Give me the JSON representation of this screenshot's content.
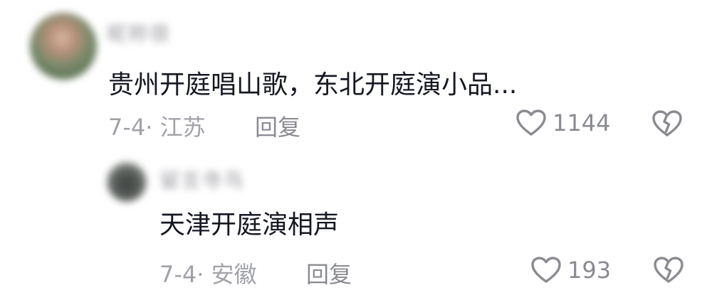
{
  "comments": [
    {
      "username": "昵称很",
      "text": "贵州开庭唱山歌，东北开庭演小品...",
      "meta": "7-4· 江苏",
      "reply_label": "回复",
      "likes": "1144"
    }
  ],
  "replies": [
    {
      "username": "留言寺鸟",
      "text": "天津开庭演相声",
      "meta": "7-4· 安徽",
      "reply_label": "回复",
      "likes": "193"
    }
  ],
  "icons": {
    "like": "heart-icon",
    "dislike": "broken-heart-icon"
  },
  "colors": {
    "text": "#161823",
    "secondary": "#a1a2a8",
    "icon": "#8a8b91"
  }
}
